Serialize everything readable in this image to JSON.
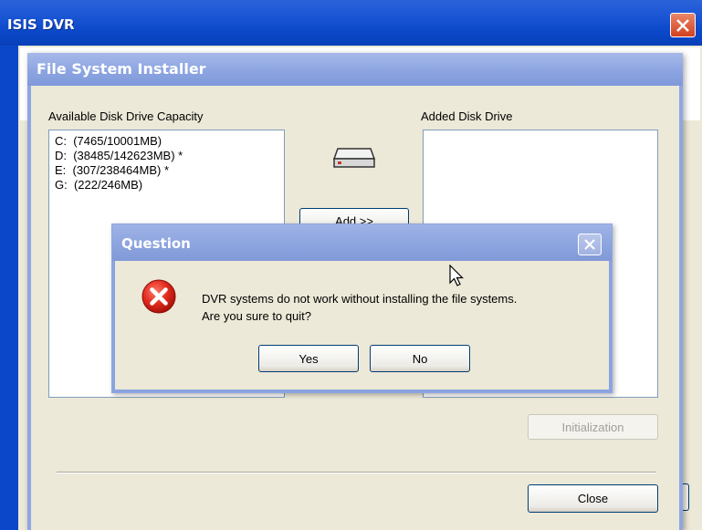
{
  "outer_window": {
    "title": "ISIS DVR"
  },
  "installer": {
    "title": "File System Installer",
    "available_label": "Available Disk Drive Capacity",
    "added_label": "Added Disk Drive",
    "drives": [
      "C:  (7465/10001MB)",
      "D:  (38485/142623MB) *",
      "E:  (307/238464MB) *",
      "G:  (222/246MB)"
    ],
    "add_button": "Add >>",
    "initialization_button": "Initialization",
    "close_button": "Close"
  },
  "question": {
    "title": "Question",
    "message_line1": "DVR systems do not work without installing the file systems.",
    "message_line2": "Are you sure to quit?",
    "yes_button": "Yes",
    "no_button": "No"
  }
}
